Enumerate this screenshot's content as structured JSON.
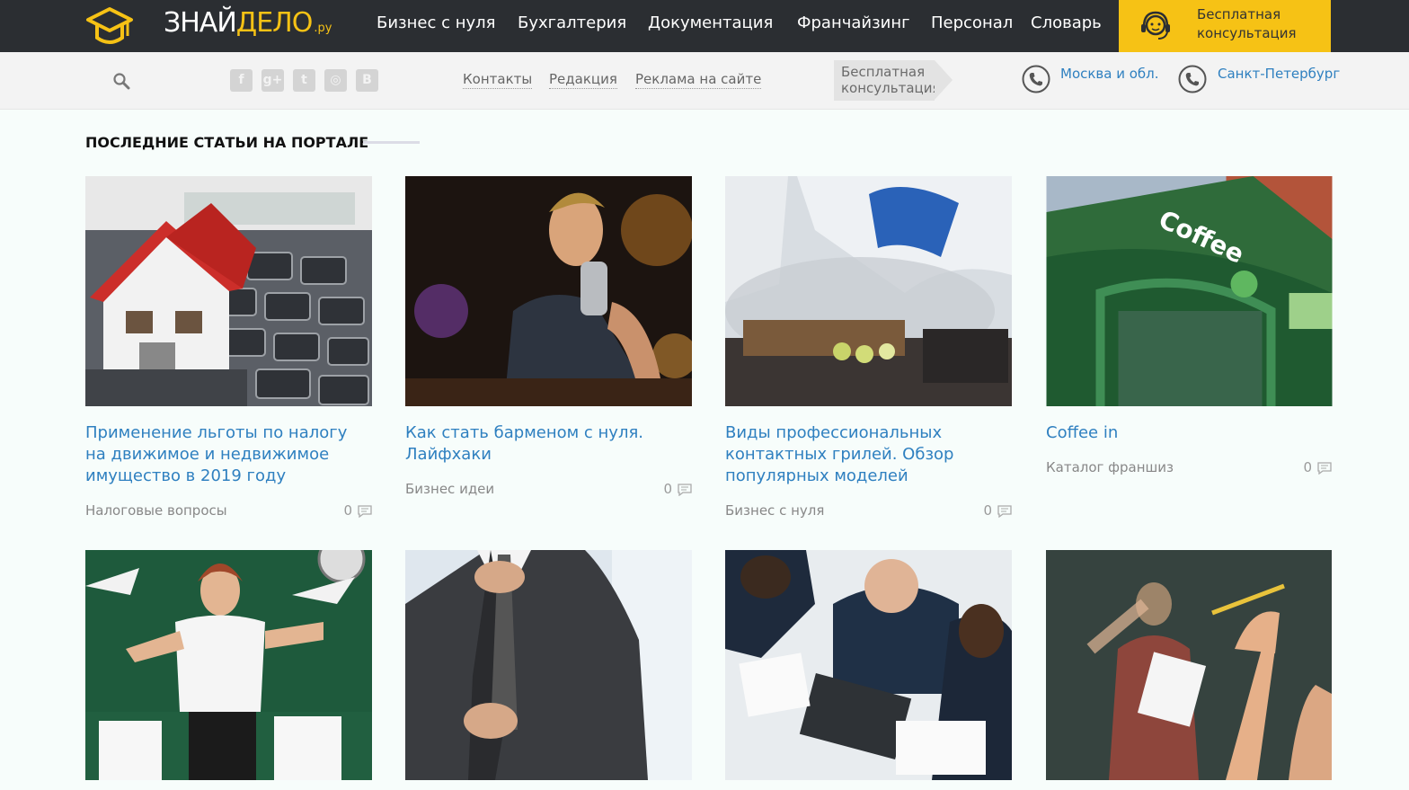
{
  "header": {
    "logo": {
      "part1": "ЗНАЙ",
      "part2": "ДЕЛО",
      "suffix": ".ру"
    },
    "nav": [
      "Бизнес с нуля",
      "Бухгалтерия",
      "Документация",
      "Франчайзинг",
      "Персонал",
      "Словарь"
    ],
    "consult_label": "Бесплатная консультация"
  },
  "subbar": {
    "social_icons": [
      "facebook-icon",
      "google-plus-icon",
      "twitter-icon",
      "instagram-icon",
      "vk-icon"
    ],
    "links": [
      "Контакты",
      "Редакция",
      "Реклама на сайте"
    ],
    "consult_tag": "Бесплатная консультация",
    "cities": [
      "Москва и обл.",
      "Санкт-Петербург"
    ]
  },
  "section": {
    "title": "ПОСЛЕДНИЕ СТАТЬИ НА ПОРТАЛЕ"
  },
  "articles": [
    {
      "title": "Применение льготы по налогу на движимое и недвижимое имущество в 2019 году",
      "category": "Налоговые вопросы",
      "comments": "0"
    },
    {
      "title": "Как стать барменом с нуля. Лайфхаки",
      "category": "Бизнес идеи",
      "comments": "0"
    },
    {
      "title": "Виды профессиональных контактных грилей. Обзор популярных моделей",
      "category": "Бизнес с нуля",
      "comments": "0"
    },
    {
      "title": "Coffee in",
      "category": "Каталог франшиз",
      "comments": "0"
    }
  ],
  "colors": {
    "topbar": "#2b2e32",
    "accent": "#f6c215",
    "link": "#2f80c0"
  }
}
